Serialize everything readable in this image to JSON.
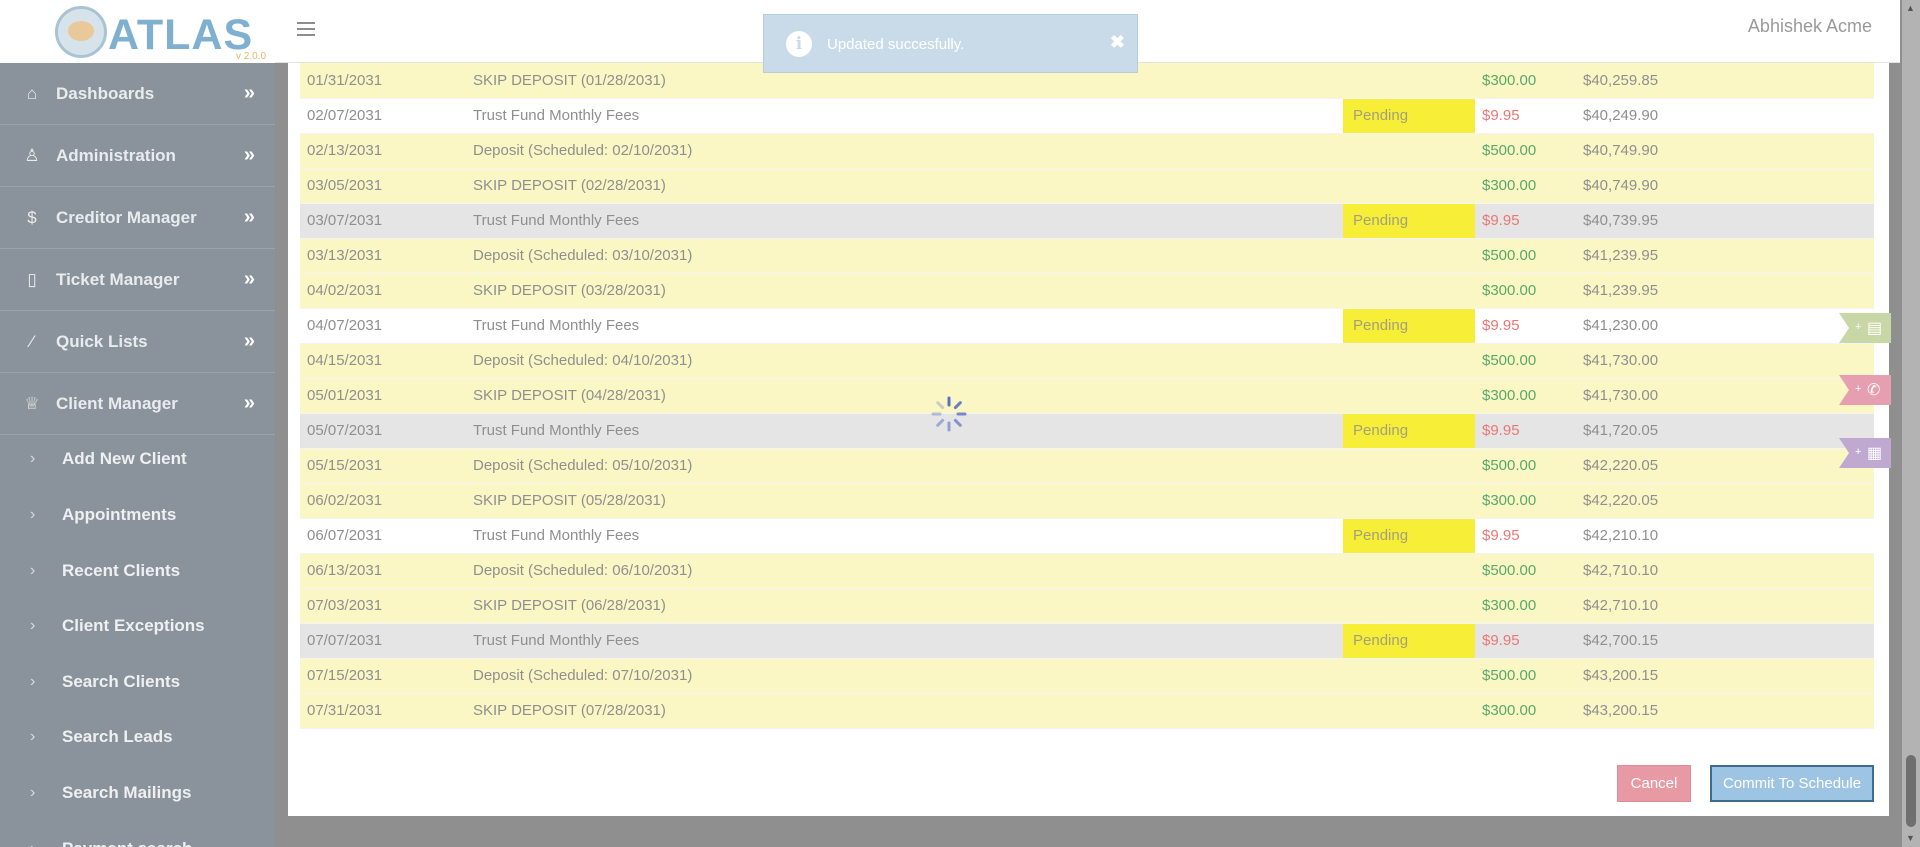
{
  "app": {
    "logo_text": "ATLAS",
    "version": "v 2.0.0"
  },
  "header": {
    "user_name": "Abhishek Acme"
  },
  "toast": {
    "message": "Updated succesfully.",
    "close_label": "✖"
  },
  "sidebar": {
    "items": [
      {
        "label": "Dashboards",
        "icon": "home-icon"
      },
      {
        "label": "Administration",
        "icon": "user-icon"
      },
      {
        "label": "Creditor Manager",
        "icon": "dollar-icon"
      },
      {
        "label": "Ticket Manager",
        "icon": "building-icon"
      },
      {
        "label": "Quick Lists",
        "icon": "wand-icon"
      },
      {
        "label": "Client Manager",
        "icon": "crown-icon"
      }
    ],
    "sub_items": [
      {
        "label": "Add New Client"
      },
      {
        "label": "Appointments"
      },
      {
        "label": "Recent Clients"
      },
      {
        "label": "Client Exceptions"
      },
      {
        "label": "Search Clients"
      },
      {
        "label": "Search Leads"
      },
      {
        "label": "Search Mailings"
      },
      {
        "label": "Payment search"
      }
    ]
  },
  "schedule": {
    "rows": [
      {
        "date": "01/31/2031",
        "description": "SKIP DEPOSIT (01/28/2031)",
        "status": "",
        "amount": "$300.00",
        "balance": "$40,259.85",
        "row_color": "yellow",
        "amount_type": "pos"
      },
      {
        "date": "02/07/2031",
        "description": "Trust Fund Monthly Fees",
        "status": "Pending",
        "amount": "$9.95",
        "balance": "$40,249.90",
        "row_color": "white",
        "amount_type": "neg"
      },
      {
        "date": "02/13/2031",
        "description": "Deposit (Scheduled: 02/10/2031)",
        "status": "",
        "amount": "$500.00",
        "balance": "$40,749.90",
        "row_color": "yellow",
        "amount_type": "pos"
      },
      {
        "date": "03/05/2031",
        "description": "SKIP DEPOSIT (02/28/2031)",
        "status": "",
        "amount": "$300.00",
        "balance": "$40,749.90",
        "row_color": "yellow",
        "amount_type": "pos"
      },
      {
        "date": "03/07/2031",
        "description": "Trust Fund Monthly Fees",
        "status": "Pending",
        "amount": "$9.95",
        "balance": "$40,739.95",
        "row_color": "gray",
        "amount_type": "neg"
      },
      {
        "date": "03/13/2031",
        "description": "Deposit (Scheduled: 03/10/2031)",
        "status": "",
        "amount": "$500.00",
        "balance": "$41,239.95",
        "row_color": "yellow",
        "amount_type": "pos"
      },
      {
        "date": "04/02/2031",
        "description": "SKIP DEPOSIT (03/28/2031)",
        "status": "",
        "amount": "$300.00",
        "balance": "$41,239.95",
        "row_color": "yellow",
        "amount_type": "pos"
      },
      {
        "date": "04/07/2031",
        "description": "Trust Fund Monthly Fees",
        "status": "Pending",
        "amount": "$9.95",
        "balance": "$41,230.00",
        "row_color": "white",
        "amount_type": "neg"
      },
      {
        "date": "04/15/2031",
        "description": "Deposit (Scheduled: 04/10/2031)",
        "status": "",
        "amount": "$500.00",
        "balance": "$41,730.00",
        "row_color": "yellow",
        "amount_type": "pos"
      },
      {
        "date": "05/01/2031",
        "description": "SKIP DEPOSIT (04/28/2031)",
        "status": "",
        "amount": "$300.00",
        "balance": "$41,730.00",
        "row_color": "yellow",
        "amount_type": "pos"
      },
      {
        "date": "05/07/2031",
        "description": "Trust Fund Monthly Fees",
        "status": "Pending",
        "amount": "$9.95",
        "balance": "$41,720.05",
        "row_color": "gray",
        "amount_type": "neg"
      },
      {
        "date": "05/15/2031",
        "description": "Deposit (Scheduled: 05/10/2031)",
        "status": "",
        "amount": "$500.00",
        "balance": "$42,220.05",
        "row_color": "yellow",
        "amount_type": "pos"
      },
      {
        "date": "06/02/2031",
        "description": "SKIP DEPOSIT (05/28/2031)",
        "status": "",
        "amount": "$300.00",
        "balance": "$42,220.05",
        "row_color": "yellow",
        "amount_type": "pos"
      },
      {
        "date": "06/07/2031",
        "description": "Trust Fund Monthly Fees",
        "status": "Pending",
        "amount": "$9.95",
        "balance": "$42,210.10",
        "row_color": "white",
        "amount_type": "neg"
      },
      {
        "date": "06/13/2031",
        "description": "Deposit (Scheduled: 06/10/2031)",
        "status": "",
        "amount": "$500.00",
        "balance": "$42,710.10",
        "row_color": "yellow",
        "amount_type": "pos"
      },
      {
        "date": "07/03/2031",
        "description": "SKIP DEPOSIT (06/28/2031)",
        "status": "",
        "amount": "$300.00",
        "balance": "$42,710.10",
        "row_color": "yellow",
        "amount_type": "pos"
      },
      {
        "date": "07/07/2031",
        "description": "Trust Fund Monthly Fees",
        "status": "Pending",
        "amount": "$9.95",
        "balance": "$42,700.15",
        "row_color": "gray",
        "amount_type": "neg"
      },
      {
        "date": "07/15/2031",
        "description": "Deposit (Scheduled: 07/10/2031)",
        "status": "",
        "amount": "$500.00",
        "balance": "$43,200.15",
        "row_color": "yellow",
        "amount_type": "pos"
      },
      {
        "date": "07/31/2031",
        "description": "SKIP DEPOSIT (07/28/2031)",
        "status": "",
        "amount": "$300.00",
        "balance": "$43,200.15",
        "row_color": "yellow",
        "amount_type": "pos"
      }
    ]
  },
  "actions": {
    "cancel_label": "Cancel",
    "commit_label": "Commit To Schedule"
  },
  "side_tabs": [
    {
      "plus": "+",
      "icon": "document-icon",
      "color": "#c9d7a6"
    },
    {
      "plus": "+",
      "icon": "phone-icon",
      "color": "#e69fb0"
    },
    {
      "plus": "+",
      "icon": "calendar-icon",
      "color": "#c0a9d1"
    }
  ],
  "colors": {
    "sidebar_bg": "#8a939b",
    "row_yellow": "#fbf7c4",
    "row_gray": "#e6e5e5",
    "pending_bg": "#f7ee38",
    "amount_positive": "#5aa86b",
    "amount_negative": "#e97777",
    "toast_bg": "#c9dbe8"
  }
}
